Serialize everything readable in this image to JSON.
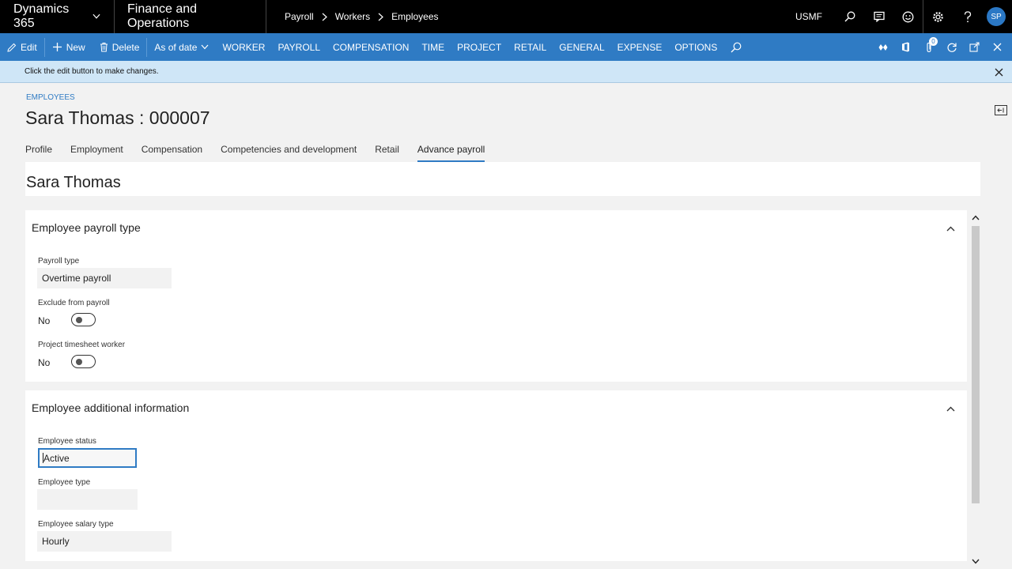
{
  "topbar": {
    "brand": "Dynamics 365",
    "app": "Finance and Operations",
    "breadcrumbs": [
      "Payroll",
      "Workers",
      "Employees"
    ],
    "company": "USMF",
    "avatar_initials": "SP",
    "icons": [
      "search-icon",
      "chat-icon",
      "smiley-icon",
      "gear-icon",
      "help-icon"
    ]
  },
  "actionbar": {
    "edit": "Edit",
    "new": "New",
    "delete": "Delete",
    "as_of_date": "As of date",
    "menus": [
      "WORKER",
      "PAYROLL",
      "COMPENSATION",
      "TIME",
      "PROJECT",
      "RETAIL",
      "GENERAL",
      "EXPENSE",
      "OPTIONS"
    ],
    "notification_count": "0"
  },
  "message": {
    "text": "Click the edit button to make changes."
  },
  "header": {
    "crumb": "EMPLOYEES",
    "title": "Sara Thomas : 000007"
  },
  "tabs": [
    "Profile",
    "Employment",
    "Compensation",
    "Competencies and development",
    "Retail",
    "Advance payroll"
  ],
  "active_tab": "Advance payroll",
  "name_card": "Sara Thomas",
  "section_payroll": {
    "title": "Employee payroll type",
    "payroll_type_label": "Payroll type",
    "payroll_type_value": "Overtime payroll",
    "exclude_label": "Exclude from payroll",
    "exclude_value": "No",
    "timesheet_label": "Project timesheet worker",
    "timesheet_value": "No"
  },
  "section_additional": {
    "title": "Employee additional information",
    "status_label": "Employee status",
    "status_value": "Active",
    "type_label": "Employee type",
    "type_value": "",
    "salary_label": "Employee salary type",
    "salary_value": "Hourly"
  },
  "colors": {
    "accent": "#2f7bc4",
    "topbar": "#000000",
    "message_bg": "#cfe6f7"
  }
}
